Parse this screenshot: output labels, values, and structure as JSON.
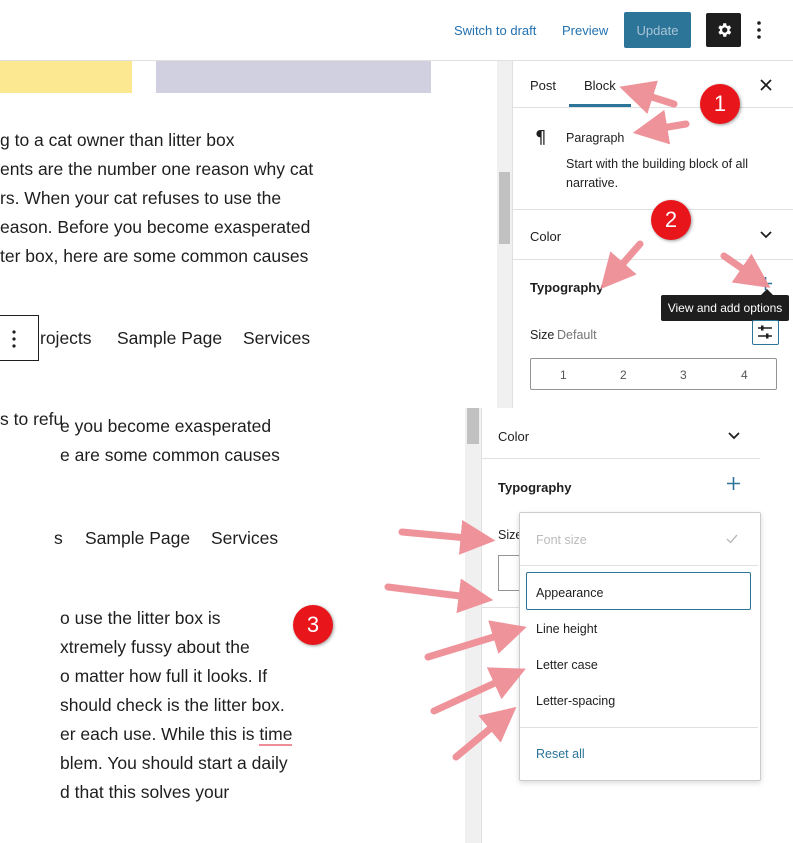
{
  "toolbar": {
    "switch_to_draft": "Switch to draft",
    "preview": "Preview",
    "update": "Update",
    "settings_icon": "gear-icon",
    "more_icon": "vertical-ellipsis-icon"
  },
  "content_top": {
    "paragraph_lines": [
      "g to a cat owner than litter box",
      "ents are the number one reason why cat",
      "rs. When your cat refuses to use the",
      "eason. Before you become exasperated",
      "ter box, here are some common causes"
    ],
    "nav_items": [
      "rojects",
      "Sample Page",
      "Services"
    ],
    "fragment_line": "s to refu"
  },
  "content_bottom": {
    "lines_a": [
      "e you become exasperated",
      "e are some common causes"
    ],
    "nav_items": [
      "s",
      "Sample Page",
      "Services"
    ],
    "paragraph_lines": [
      "o use the litter box is",
      "xtremely fussy about the",
      "o matter how full it looks. If",
      "should check is the litter box.",
      "er each use. While this is",
      "blem. You should start a daily",
      "d that this solves your"
    ],
    "underlined_word": "time"
  },
  "sidebar": {
    "tabs": [
      "Post",
      "Block"
    ],
    "close_icon": "close-icon",
    "block_icon": "pilcrow-icon",
    "block_name": "Paragraph",
    "block_description_lines": [
      "Start with the building block of all",
      "narrative."
    ],
    "color_heading": "Color",
    "typography_heading": "Typography",
    "add_icon": "plus-icon",
    "tooltip": "View and add options",
    "size_label": "Size",
    "size_value": "Default",
    "size_options": [
      "1",
      "2",
      "3",
      "4"
    ]
  },
  "sidebar2": {
    "color_heading": "Color",
    "typography_heading": "Typography",
    "size_label_partial": "Size"
  },
  "dropdown": {
    "items": [
      {
        "label": "Font size",
        "disabled": true,
        "checked": true
      },
      {
        "label": "Appearance",
        "focused": true
      },
      {
        "label": "Line height"
      },
      {
        "label": "Letter case"
      },
      {
        "label": "Letter-spacing"
      }
    ],
    "reset": "Reset all"
  },
  "markers": [
    "1",
    "2",
    "3"
  ],
  "colors": {
    "accent": "#2d7499",
    "marker": "#e8151b",
    "arrow": "#ef8e96",
    "swatch_yellow": "#fde892",
    "swatch_lavender": "#d1d0e0"
  }
}
